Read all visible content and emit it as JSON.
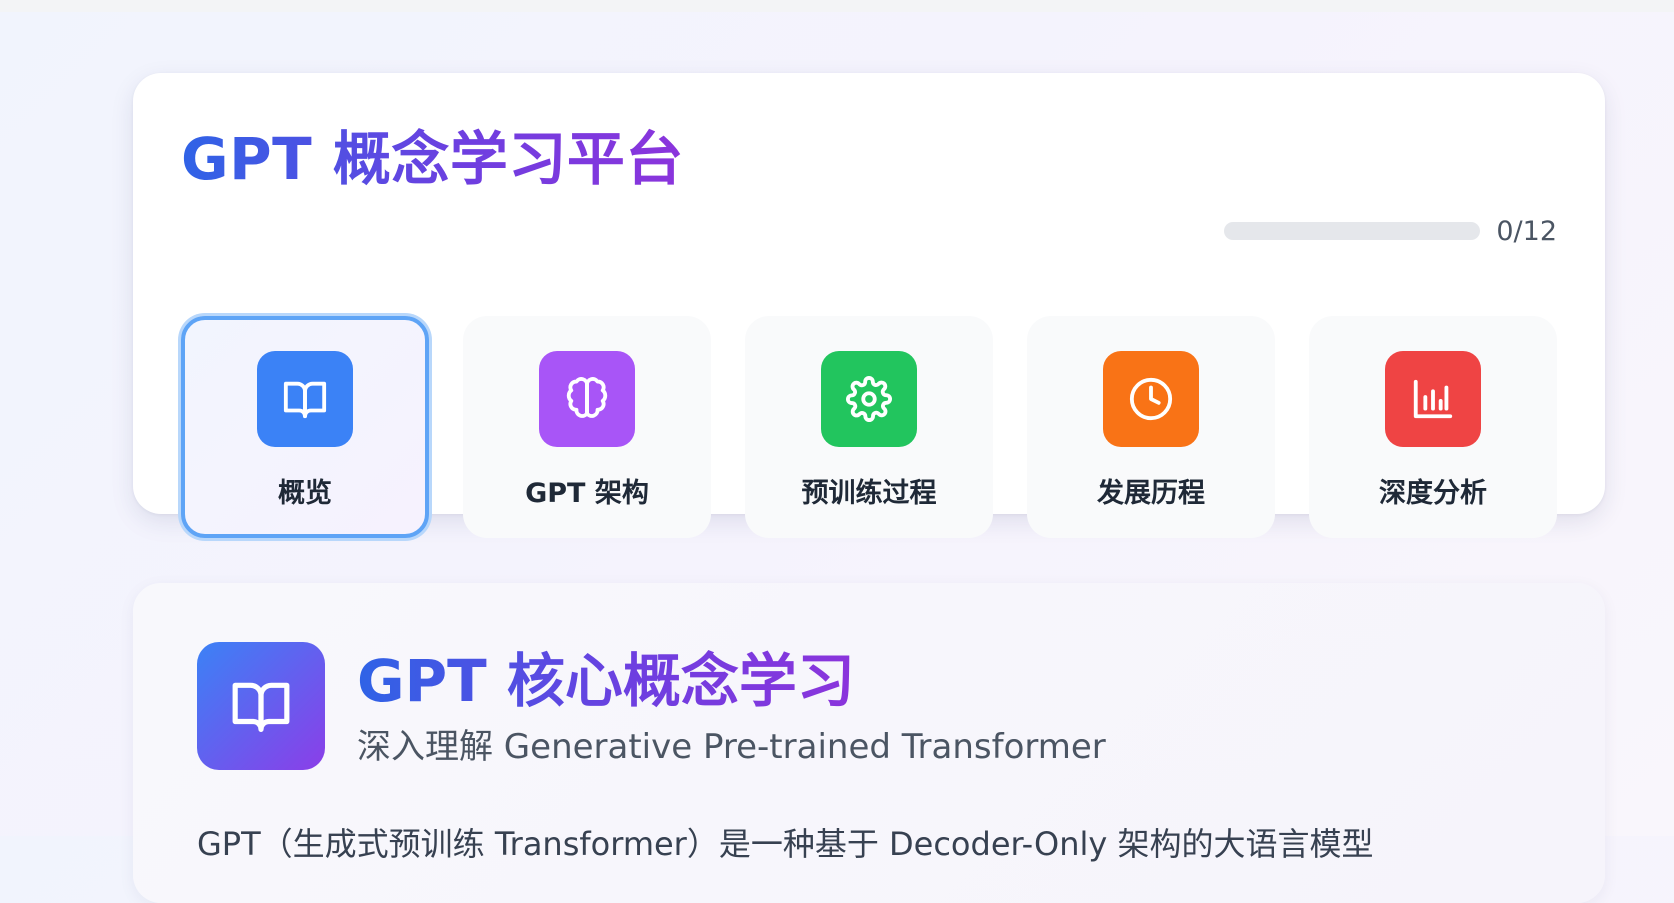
{
  "header": {
    "title": "GPT 概念学习平台",
    "progress": {
      "completed": 0,
      "total": 12,
      "label": "0/12"
    }
  },
  "nav": {
    "items": [
      {
        "label": "概览",
        "icon": "book-open-icon",
        "color": "#3b82f6",
        "active": true
      },
      {
        "label": "GPT 架构",
        "icon": "brain-icon",
        "color": "#a855f7",
        "active": false
      },
      {
        "label": "预训练过程",
        "icon": "gear-icon",
        "color": "#22c55e",
        "active": false
      },
      {
        "label": "发展历程",
        "icon": "clock-icon",
        "color": "#f97316",
        "active": false
      },
      {
        "label": "深度分析",
        "icon": "bar-chart-icon",
        "color": "#ef4444",
        "active": false
      }
    ]
  },
  "section": {
    "icon": "book-open-icon",
    "title": "GPT 核心概念学习",
    "subtitle": "深入理解 Generative Pre-trained Transformer",
    "body": "GPT（生成式预训练 Transformer）是一种基于 Decoder-Only 架构的大语言模型"
  }
}
